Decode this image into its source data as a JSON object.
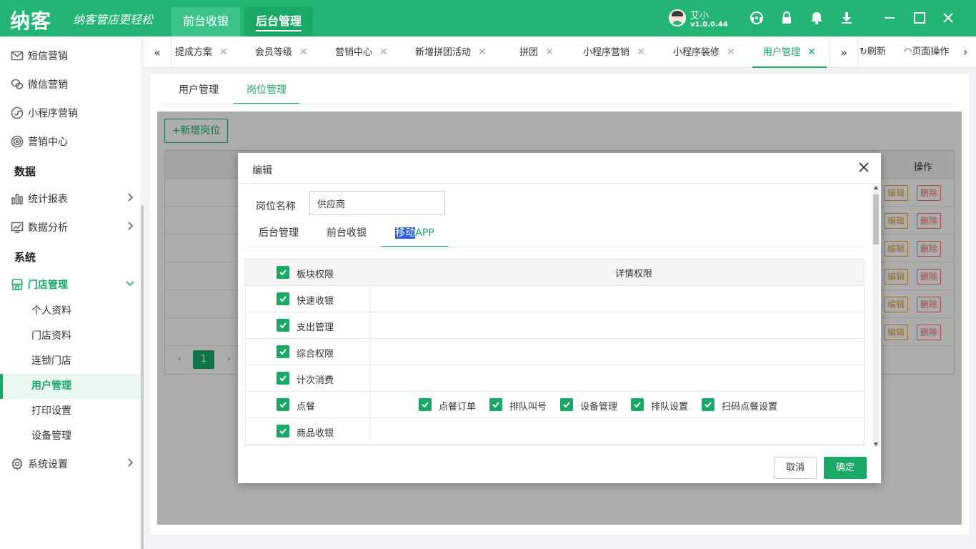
{
  "brand": {
    "logo": "纳客",
    "slogan": "纳客管店更轻松"
  },
  "top_tabs": [
    {
      "label": "前台收银",
      "active": false
    },
    {
      "label": "后台管理",
      "active": true
    }
  ],
  "user": {
    "name": "艾小",
    "version": "v1.0.0.44"
  },
  "top_icons": [
    "support-icon",
    "lock-icon",
    "bell-icon",
    "download-icon",
    "minimize-icon",
    "maximize-icon",
    "close-icon"
  ],
  "sidebar": {
    "items": [
      {
        "label": "短信营销",
        "icon": "mail-icon"
      },
      {
        "label": "微信营销",
        "icon": "wechat-icon"
      },
      {
        "label": "小程序营销",
        "icon": "miniprogram-icon"
      },
      {
        "label": "营销中心",
        "icon": "target-icon"
      }
    ],
    "section_data": "数据",
    "data_items": [
      {
        "label": "统计报表",
        "icon": "bar-chart-icon"
      },
      {
        "label": "数据分析",
        "icon": "line-chart-icon"
      }
    ],
    "section_system": "系统",
    "store_mgmt": {
      "label": "门店管理",
      "icon": "store-icon"
    },
    "store_subitems": [
      {
        "label": "个人资料",
        "active": false
      },
      {
        "label": "门店资料",
        "active": false
      },
      {
        "label": "连锁门店",
        "active": false
      },
      {
        "label": "用户管理",
        "active": true
      },
      {
        "label": "打印设置",
        "active": false
      },
      {
        "label": "设备管理",
        "active": false
      }
    ],
    "settings": {
      "label": "系统设置",
      "icon": "gear-icon"
    }
  },
  "page_tabs": [
    {
      "label": "提成方案",
      "active": false
    },
    {
      "label": "会员等级",
      "active": false
    },
    {
      "label": "营销中心",
      "active": false
    },
    {
      "label": "新增拼团活动",
      "active": false
    },
    {
      "label": "拼团",
      "active": false
    },
    {
      "label": "小程序营销",
      "active": false
    },
    {
      "label": "小程序装修",
      "active": false
    },
    {
      "label": "用户管理",
      "active": true
    }
  ],
  "tab_actions": {
    "refresh": "刷新",
    "page_ops": "页面操作"
  },
  "sub_tabs": [
    {
      "label": "用户管理",
      "active": false
    },
    {
      "label": "岗位管理",
      "active": true
    }
  ],
  "content": {
    "add_button": "+新增岗位",
    "table_header_action": "操作",
    "row_edit": "编辑",
    "row_delete": "删除",
    "row_count": 6,
    "current_page": "1"
  },
  "modal": {
    "title": "编辑",
    "field_label": "岗位名称",
    "field_value": "供应商",
    "tabs": [
      {
        "label": "后台管理",
        "active": false
      },
      {
        "label": "前台收银",
        "active": false
      },
      {
        "label": "移动APP",
        "active": true,
        "selected_text": "移动",
        "rest_text": "APP"
      }
    ],
    "table": {
      "col_block": "板块权限",
      "col_detail": "详情权限",
      "rows": [
        {
          "label": "快速收银",
          "checked": true,
          "details": []
        },
        {
          "label": "支出管理",
          "checked": true,
          "details": []
        },
        {
          "label": "综合权限",
          "checked": true,
          "details": []
        },
        {
          "label": "计次消费",
          "checked": true,
          "details": []
        },
        {
          "label": "点餐",
          "checked": true,
          "details": [
            "点餐订单",
            "排队叫号",
            "设备管理",
            "排队设置",
            "扫码点餐设置"
          ]
        },
        {
          "label": "商品收银",
          "checked": true,
          "details": []
        }
      ]
    },
    "cancel": "取消",
    "confirm": "确定"
  },
  "colors": {
    "brand_green": "#22b573",
    "active_green": "#1aa866",
    "edit_orange": "#e6a23c",
    "delete_red": "#f56c6c"
  }
}
